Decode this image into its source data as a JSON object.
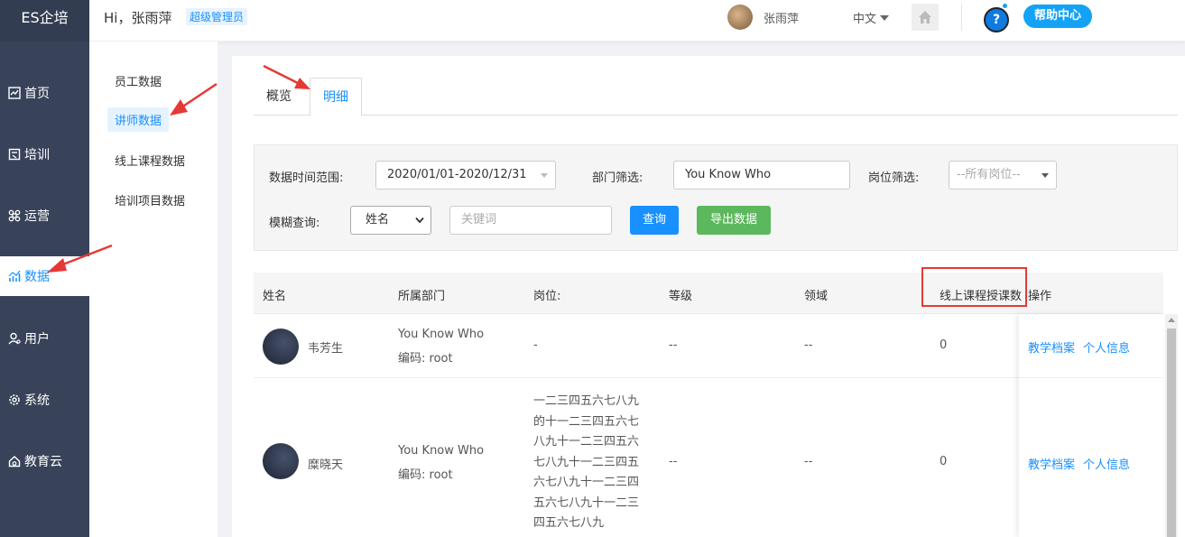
{
  "app": {
    "brand": "ES企培"
  },
  "header": {
    "greeting": "Hi，张雨萍",
    "role_badge": "超级管理员",
    "user_name": "张雨萍",
    "language": "中文",
    "help_label": "帮助中心",
    "help_icon": "?"
  },
  "nav": {
    "items": [
      {
        "label": "首页",
        "icon": "dashboard-icon"
      },
      {
        "label": "培训",
        "icon": "training-icon"
      },
      {
        "label": "运营",
        "icon": "operations-icon"
      },
      {
        "label": "数据",
        "icon": "chart-icon",
        "active": true
      },
      {
        "label": "用户",
        "icon": "user-icon"
      },
      {
        "label": "系统",
        "icon": "gear-icon"
      },
      {
        "label": "教育云",
        "icon": "cloud-icon"
      }
    ]
  },
  "subnav": {
    "items": [
      {
        "label": "员工数据"
      },
      {
        "label": "讲师数据",
        "active": true
      },
      {
        "label": "线上课程数据"
      },
      {
        "label": "培训项目数据"
      }
    ]
  },
  "tabs": [
    {
      "label": "概览"
    },
    {
      "label": "明细",
      "active": true
    }
  ],
  "filters": {
    "date_label": "数据时间范围:",
    "date_value": "2020/01/01-2020/12/31",
    "dept_label": "部门筛选:",
    "dept_value": "You Know Who",
    "post_label": "岗位筛选:",
    "post_value": "--所有岗位--",
    "fuzzy_label": "模糊查询:",
    "fuzzy_field": "姓名",
    "keyword_placeholder": "关键词",
    "query_button": "查询",
    "export_button": "导出数据"
  },
  "table": {
    "columns": [
      "姓名",
      "所属部门",
      "岗位:",
      "等级",
      "领域",
      "线上课程授课数",
      "操作"
    ],
    "rows": [
      {
        "name": "韦芳生",
        "dept": "You Know Who",
        "code": "编码:  root",
        "post": "-",
        "level": "--",
        "field": "--",
        "count": "0",
        "op1": "教学档案",
        "op2": "个人信息"
      },
      {
        "name": "糜晓天",
        "dept": "You Know Who",
        "code": "编码:  root",
        "post_lines": [
          "一二三四五六七八九",
          "的十一二三四五六七",
          "八九十一二三四五六",
          "七八九十一二三四五",
          "六七八九十一二三四",
          "五六七八九十一二三",
          "四五六七八九"
        ],
        "level": "--",
        "field": "--",
        "count": "0",
        "op1": "教学档案",
        "op2": "个人信息"
      }
    ]
  },
  "colors": {
    "nav_bg": "#38435a",
    "accent": "#1890ff",
    "export_green": "#5cb85c",
    "annotation_red": "#e53935"
  }
}
